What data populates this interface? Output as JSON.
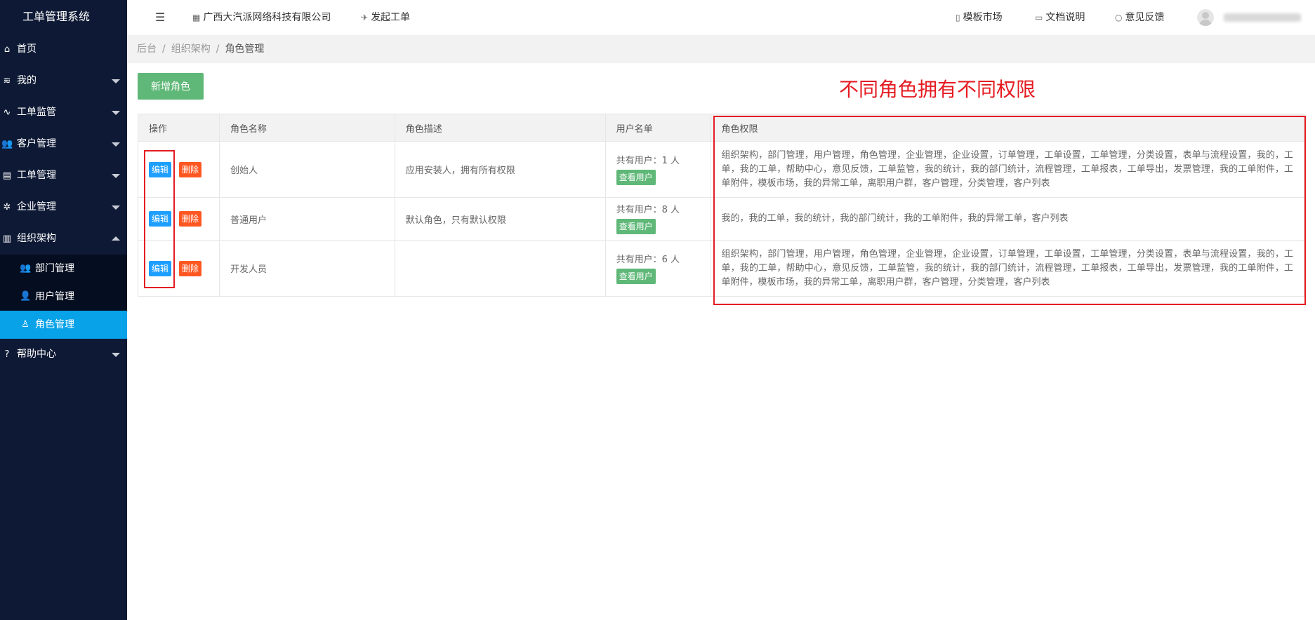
{
  "sidebar": {
    "brand": "工单管理系统",
    "items": [
      {
        "label": "首页",
        "icon": "home-icon"
      },
      {
        "label": "我的",
        "icon": "layers-icon"
      },
      {
        "label": "工单监管",
        "icon": "pulse-icon"
      },
      {
        "label": "客户管理",
        "icon": "users-icon"
      },
      {
        "label": "工单管理",
        "icon": "file-icon"
      },
      {
        "label": "企业管理",
        "icon": "gear-icon"
      },
      {
        "label": "组织架构",
        "icon": "org-icon"
      }
    ],
    "subitems": [
      {
        "label": "部门管理",
        "icon": "users-icon"
      },
      {
        "label": "用户管理",
        "icon": "user-icon"
      },
      {
        "label": "角色管理",
        "icon": "user-outline-icon"
      }
    ],
    "help": {
      "label": "帮助中心",
      "icon": "question-icon"
    }
  },
  "topbar": {
    "company": "广西大汽派网络科技有限公司",
    "new_ticket": "发起工单",
    "template_market": "模板市场",
    "docs": "文档说明",
    "feedback": "意见反馈"
  },
  "breadcrumb": {
    "home": "后台",
    "parent": "组织架构",
    "current": "角色管理"
  },
  "content": {
    "add_button": "新增角色",
    "annotation": "不同角色拥有不同权限",
    "columns": [
      "操作",
      "角色名称",
      "角色描述",
      "用户名单",
      "角色权限"
    ],
    "edit_label": "编辑",
    "delete_label": "删除",
    "view_label": "查看用户",
    "rows": [
      {
        "name": "创始人",
        "desc": "应用安装人，拥有所有权限",
        "users": "共有用户：1 人",
        "perms": "组织架构，部门管理，用户管理，角色管理，企业管理，企业设置，订单管理，工单设置，工单管理，分类设置，表单与流程设置，我的，工单，我的工单，帮助中心，意见反馈，工单监管，我的统计，我的部门统计，流程管理，工单报表，工单导出，发票管理，我的工单附件，工单附件，模板市场，我的异常工单，离职用户群，客户管理，分类管理，客户列表"
      },
      {
        "name": "普通用户",
        "desc": "默认角色，只有默认权限",
        "users": "共有用户：8 人",
        "perms": "我的，我的工单，我的统计，我的部门统计，我的工单附件，我的异常工单，客户列表"
      },
      {
        "name": "开发人员",
        "desc": "",
        "users": "共有用户：6 人",
        "perms": "组织架构，部门管理，用户管理，角色管理，企业管理，企业设置，订单管理，工单设置，工单管理，分类设置，表单与流程设置，我的，工单，我的工单，帮助中心，意见反馈，工单监管，我的统计，我的部门统计，流程管理，工单报表，工单导出，发票管理，我的工单附件，工单附件，模板市场，我的异常工单，离职用户群，客户管理，分类管理，客户列表"
      }
    ]
  },
  "colors": {
    "sidebar": "#0e1a35",
    "active": "#08a2e8",
    "green": "#5fb878",
    "blue": "#1e9fff",
    "orange": "#ff5722",
    "annotation_red": "#e51c23"
  }
}
